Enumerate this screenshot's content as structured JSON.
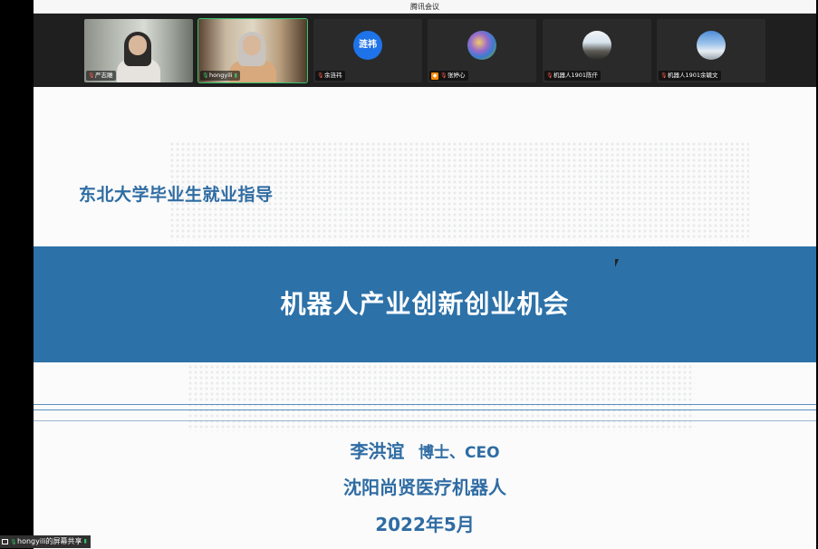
{
  "window": {
    "title": "腾讯会议"
  },
  "participants": [
    {
      "name": "严志雕",
      "mic": "muted",
      "kind": "camera1"
    },
    {
      "name": "hongyili",
      "mic": "on",
      "kind": "camera2",
      "speaking": true
    },
    {
      "name": "余涟祎",
      "mic": "muted",
      "kind": "avatar-text",
      "avatar_text": "涟祎"
    },
    {
      "name": "张婷心",
      "mic": "muted",
      "kind": "avatar-photo"
    },
    {
      "name": "机器人1901陈仟",
      "mic": "muted",
      "kind": "avatar-photo"
    },
    {
      "name": "机器人1901余毓文",
      "mic": "muted",
      "kind": "avatar-photo"
    }
  ],
  "slide": {
    "subtitle": "东北大学毕业生就业指导",
    "title": "机器人产业创新创业机会",
    "presenter_name": "李洪谊",
    "presenter_role": "博士、CEO",
    "company": "沈阳尚贤医疗机器人",
    "date": "2022年5月"
  },
  "share_badge": {
    "label": "hongyili的屏幕共享"
  },
  "icons": {
    "mic_muted": "mic-muted-icon",
    "mic_on": "mic-on-icon",
    "signal": "signal-icon",
    "side_toggle": "list-icon",
    "screen_share": "screen-share-icon"
  },
  "colors": {
    "accent": "#2c71a8",
    "text_blue": "#2f6ca3",
    "speaking": "#35c26a"
  }
}
